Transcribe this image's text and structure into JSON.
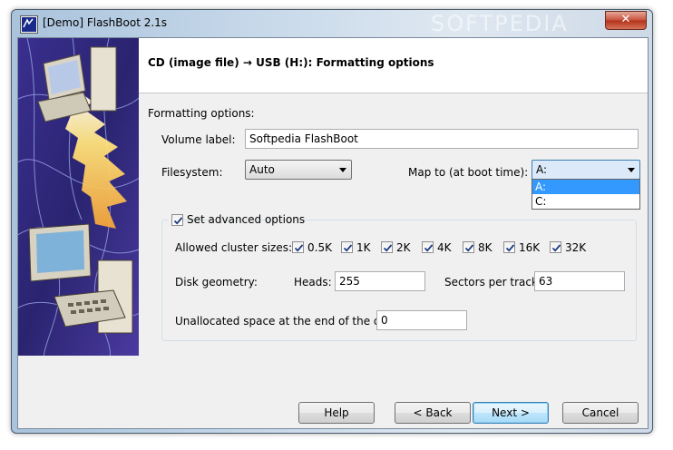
{
  "window": {
    "title": "[Demo] FlashBoot 2.1s",
    "close_glyph": "✕",
    "watermark": "SOFTPEDIA"
  },
  "header": {
    "title": "CD (image file) → USB (H:): Formatting options"
  },
  "form": {
    "section_label": "Formatting options:",
    "volume_label": {
      "label": "Volume label:",
      "value": "Softpedia FlashBoot"
    },
    "filesystem": {
      "label": "Filesystem:",
      "value": "Auto"
    },
    "map_to": {
      "label": "Map to (at boot time):",
      "value": "A:",
      "options": [
        "A:",
        "C:"
      ],
      "highlighted_option": "A:"
    },
    "advanced": {
      "label": "Set advanced options",
      "checked": true,
      "cluster_sizes_label": "Allowed cluster sizes:",
      "cluster_sizes": [
        {
          "label": "0.5K",
          "checked": true
        },
        {
          "label": "1K",
          "checked": true
        },
        {
          "label": "2K",
          "checked": true
        },
        {
          "label": "4K",
          "checked": true
        },
        {
          "label": "8K",
          "checked": true
        },
        {
          "label": "16K",
          "checked": true
        },
        {
          "label": "32K",
          "checked": true
        }
      ],
      "disk_geometry_label": "Disk geometry:",
      "heads_label": "Heads:",
      "heads_value": "255",
      "sectors_label": "Sectors per track:",
      "sectors_value": "63",
      "unallocated_label": "Unallocated space at the end of the disk:",
      "unallocated_value": "0"
    }
  },
  "buttons": {
    "help": "Help",
    "back": "< Back",
    "next": "Next >",
    "cancel": "Cancel"
  },
  "colors": {
    "accent": "#3399ff",
    "art_background": "#2a2470",
    "close_button": "#c8503b"
  },
  "icons": {
    "app": "flashboot-app-icon",
    "close": "close-icon",
    "dropdown": "chevron-down-icon",
    "check": "checkmark-icon"
  }
}
